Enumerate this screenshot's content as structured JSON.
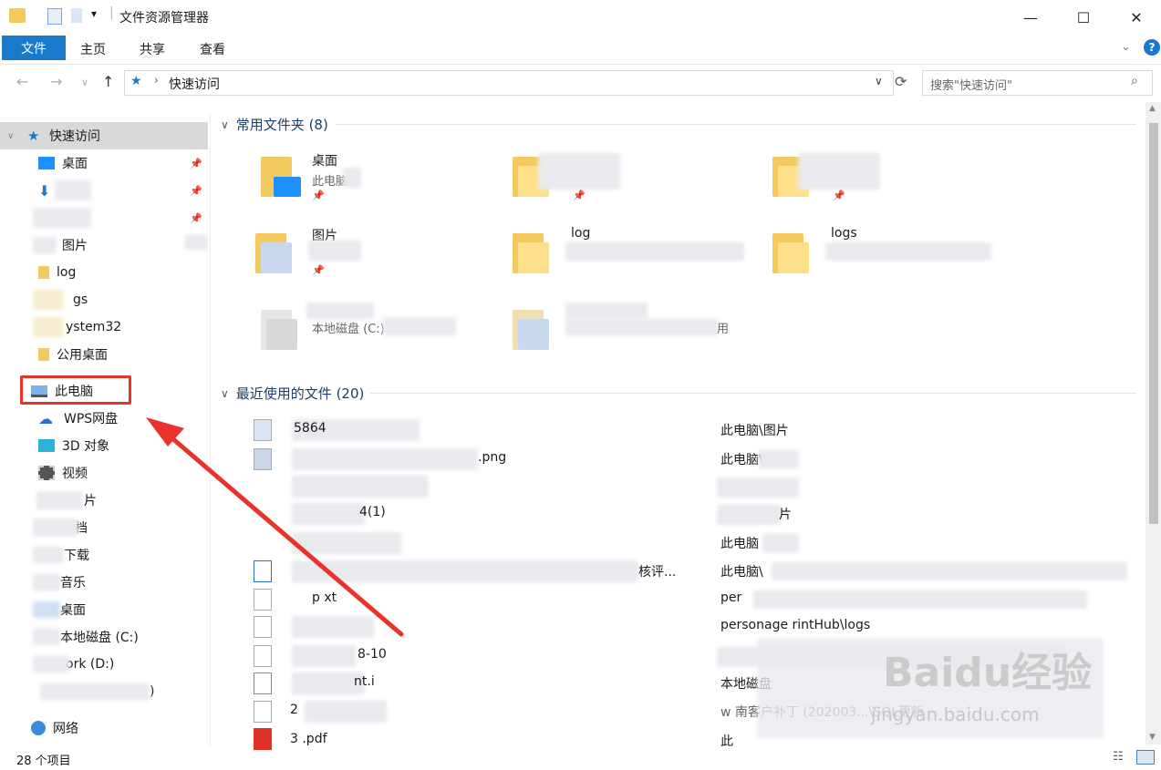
{
  "window": {
    "title": "文件资源管理器"
  },
  "ribbon": {
    "tabs": [
      "文件",
      "主页",
      "共享",
      "查看"
    ]
  },
  "address": {
    "path": "快速访问",
    "search_placeholder": "搜索\"快速访问\""
  },
  "sidebar": {
    "quick_access": "快速访问",
    "items": [
      {
        "label": "桌面",
        "pinned": true
      },
      {
        "label": "下",
        "pinned": true
      },
      {
        "label": "",
        "pinned": true
      },
      {
        "label": "图片",
        "pinned": false
      },
      {
        "label": "log",
        "pinned": false
      },
      {
        "label": "gs",
        "pinned": false
      },
      {
        "label": "ystem32",
        "pinned": false
      },
      {
        "label": "公用桌面",
        "pinned": false
      }
    ],
    "this_pc": "此电脑",
    "pc_items": [
      "WPS网盘",
      "3D 对象",
      "视频",
      "片",
      "档",
      "下载",
      "音乐",
      "桌面",
      "本地磁盘 (C:)",
      "ork (D:)",
      ")"
    ],
    "network": "网络"
  },
  "frequent": {
    "header": "常用文件夹 (8)",
    "folders": [
      {
        "name": "桌面",
        "sub": "此电脑"
      },
      {
        "name": "",
        "sub": ""
      },
      {
        "name": "",
        "sub": ""
      },
      {
        "name": "图片",
        "sub": ""
      },
      {
        "name": "log",
        "sub": ""
      },
      {
        "name": "logs",
        "sub": ""
      },
      {
        "name": "",
        "sub": "本地磁盘 (C:)"
      },
      {
        "name": "",
        "sub": "用"
      }
    ]
  },
  "recent": {
    "header": "最近使用的文件 (20)",
    "rows": [
      {
        "name": "5864",
        "path": "此电脑\\图片"
      },
      {
        "name": ".png",
        "path": "此电脑\\图"
      },
      {
        "name": "",
        "path": ""
      },
      {
        "name": "4(1)",
        "path": "片"
      },
      {
        "name": "",
        "path": "此电脑"
      },
      {
        "name": "核评...",
        "path": "此电脑\\"
      },
      {
        "name": "p   xt",
        "path": "per"
      },
      {
        "name": "",
        "path": "personage      rintHub\\logs"
      },
      {
        "name": "8-10",
        "path": ""
      },
      {
        "name": "nt.i",
        "path": "本地磁盘"
      },
      {
        "name": "2",
        "path": "w       南客户补丁 (202003...\\SQL更新"
      },
      {
        "name": "3        .pdf",
        "path": "此"
      }
    ]
  },
  "status": {
    "count": "28 个项目"
  },
  "watermark": {
    "brand": "Baidu经验",
    "url": "jingyan.baidu.com"
  },
  "colors": {
    "accent": "#1979ca",
    "highlight": "#e8322a"
  }
}
